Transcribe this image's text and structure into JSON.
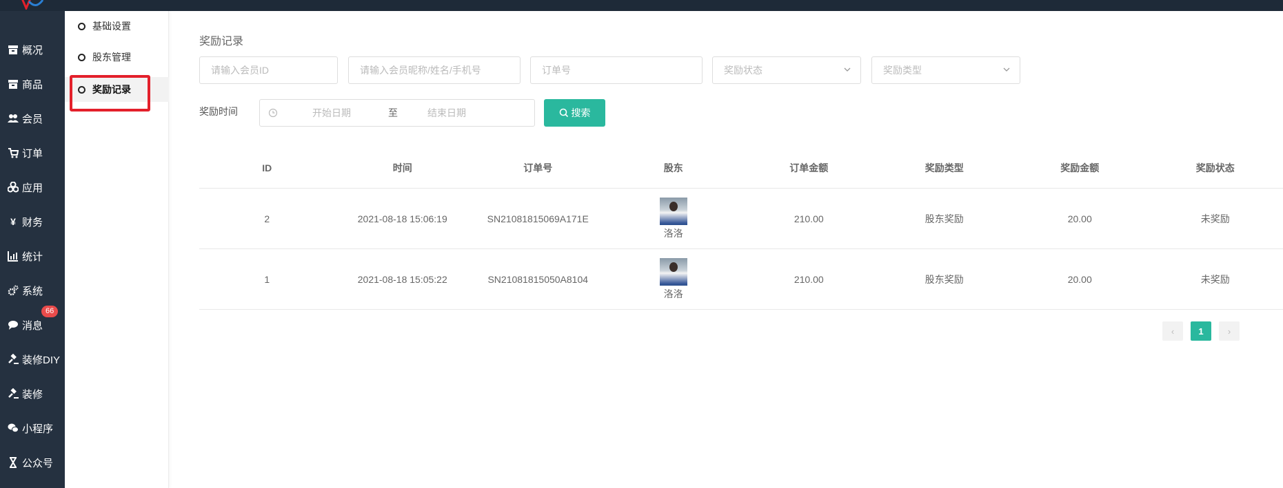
{
  "left_nav": [
    {
      "label": "概况",
      "icon": "archive-icon"
    },
    {
      "label": "商品",
      "icon": "archive-icon"
    },
    {
      "label": "会员",
      "icon": "users-icon"
    },
    {
      "label": "订单",
      "icon": "cart-icon"
    },
    {
      "label": "应用",
      "icon": "cubes-icon"
    },
    {
      "label": "财务",
      "icon": "yen-icon"
    },
    {
      "label": "统计",
      "icon": "bar-chart-icon"
    },
    {
      "label": "系统",
      "icon": "gears-icon"
    },
    {
      "label": "消息",
      "icon": "chat-icon",
      "badge": "66"
    },
    {
      "label": "装修DIY",
      "icon": "gavel-icon"
    },
    {
      "label": "装修",
      "icon": "gavel-icon"
    },
    {
      "label": "小程序",
      "icon": "wechat-icon"
    },
    {
      "label": "公众号",
      "icon": "hourglass-icon"
    }
  ],
  "sub_nav": [
    {
      "label": "基础设置",
      "active": false
    },
    {
      "label": "股东管理",
      "active": false
    },
    {
      "label": "奖励记录",
      "active": true
    }
  ],
  "page": {
    "title": "奖励记录",
    "filters": {
      "member_id_placeholder": "请输入会员ID",
      "member_info_placeholder": "请输入会员昵称/姓名/手机号",
      "order_no_placeholder": "订单号",
      "reward_status_placeholder": "奖励状态",
      "reward_type_placeholder": "奖励类型",
      "time_label": "奖励时间",
      "start_date_placeholder": "开始日期",
      "date_separator": "至",
      "end_date_placeholder": "结束日期",
      "search_button": "搜索"
    },
    "table": {
      "columns": [
        "ID",
        "时间",
        "订单号",
        "股东",
        "订单金额",
        "奖励类型",
        "奖励金额",
        "奖励状态"
      ],
      "rows": [
        {
          "id": "2",
          "time": "2021-08-18 15:06:19",
          "order_no": "SN21081815069A171E",
          "shareholder": "洛洛",
          "order_amount": "210.00",
          "reward_type": "股东奖励",
          "reward_amount": "20.00",
          "reward_status": "未奖励"
        },
        {
          "id": "1",
          "time": "2021-08-18 15:05:22",
          "order_no": "SN21081815050A8104",
          "shareholder": "洛洛",
          "order_amount": "210.00",
          "reward_type": "股东奖励",
          "reward_amount": "20.00",
          "reward_status": "未奖励"
        }
      ]
    },
    "pagination": {
      "prev": "‹",
      "current": "1",
      "next": "›"
    }
  },
  "colors": {
    "accent": "#2ab89e",
    "sidebar": "#253140",
    "topbar": "#1e2a38",
    "highlight": "#e3202b",
    "badge": "#e94b4b"
  }
}
